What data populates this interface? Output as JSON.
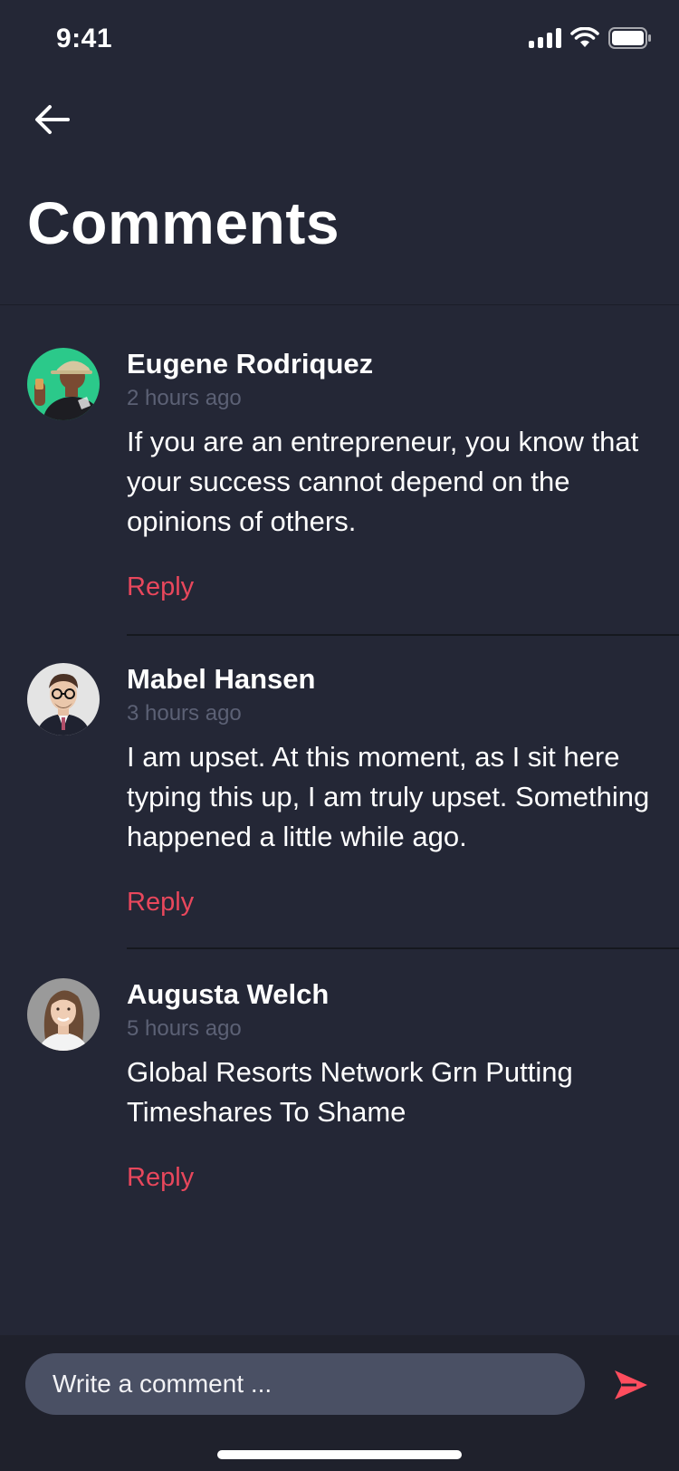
{
  "status_bar": {
    "time": "9:41",
    "icons": [
      "cellular-signal-icon",
      "wifi-icon",
      "battery-icon"
    ]
  },
  "header": {
    "back_icon": "arrow-left-icon",
    "title": "Comments"
  },
  "colors": {
    "background": "#242736",
    "accent": "#e8475c",
    "input_background": "#4a5064",
    "muted_text": "#5c6175"
  },
  "comments": [
    {
      "name": "Eugene Rodriquez",
      "time": "2 hours ago",
      "body": "If you are an entrepreneur, you know that your success cannot depend on the opinions of others.",
      "reply_label": "Reply"
    },
    {
      "name": "Mabel Hansen",
      "time": "3 hours ago",
      "body": "I am upset. At this moment, as I sit here typing this up, I am truly upset. Something happened a little while ago.",
      "reply_label": "Reply"
    },
    {
      "name": "Augusta Welch",
      "time": "5 hours ago",
      "body": "Global Resorts Network Grn Putting Timeshares To Shame",
      "reply_label": "Reply"
    }
  ],
  "composer": {
    "placeholder": "Write a comment ...",
    "send_icon": "send-icon"
  }
}
